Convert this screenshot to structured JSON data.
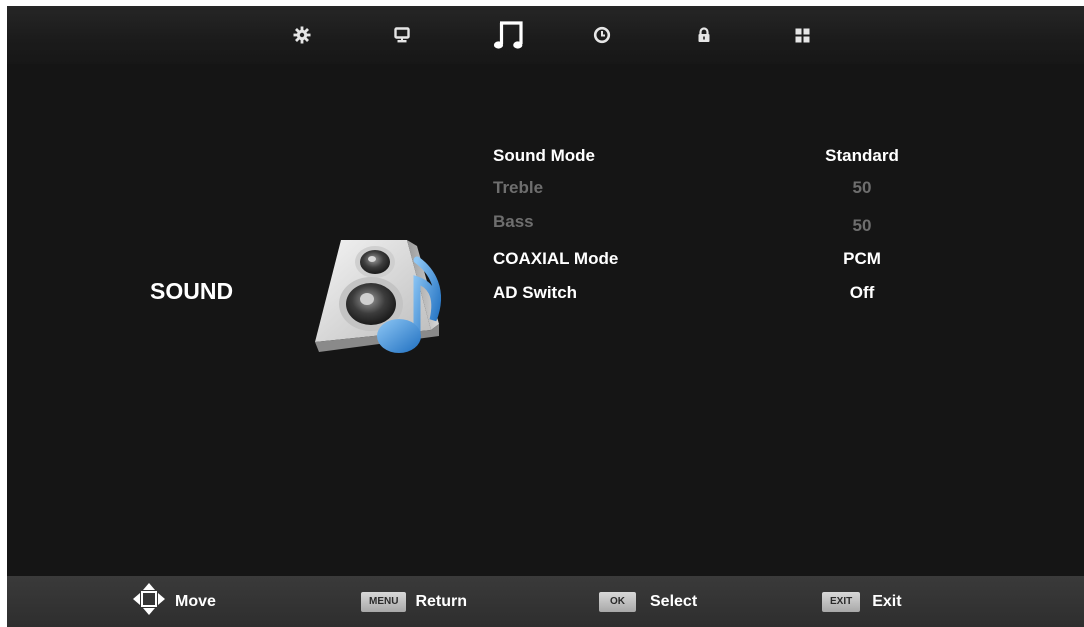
{
  "tabs": [
    {
      "name": "setup-tab",
      "icon": "gear-icon",
      "selected": false
    },
    {
      "name": "picture-tab",
      "icon": "monitor-icon",
      "selected": false
    },
    {
      "name": "sound-tab",
      "icon": "music-note-icon",
      "selected": true
    },
    {
      "name": "time-tab",
      "icon": "clock-icon",
      "selected": false
    },
    {
      "name": "lock-tab",
      "icon": "lock-icon",
      "selected": false
    },
    {
      "name": "apps-tab",
      "icon": "grid-icon",
      "selected": false
    }
  ],
  "section": {
    "title": "SOUND",
    "icon": "speaker-music-icon"
  },
  "menu": [
    {
      "label": "Sound Mode",
      "value": "Standard",
      "enabled": true
    },
    {
      "label": "Treble",
      "value": "50",
      "enabled": false
    },
    {
      "label": "Bass",
      "value": "50",
      "enabled": false
    },
    {
      "label": "COAXIAL Mode",
      "value": "PCM",
      "enabled": true
    },
    {
      "label": "AD Switch",
      "value": "Off",
      "enabled": true
    }
  ],
  "hints": {
    "move": {
      "icon": "direction-pad-icon",
      "label": "Move"
    },
    "return": {
      "key": "MENU",
      "label": "Return"
    },
    "select": {
      "key": "OK",
      "label": "Select"
    },
    "exit": {
      "key": "EXIT",
      "label": "Exit"
    }
  },
  "colors": {
    "background": "#151515",
    "text": "#ffffff",
    "disabled_text": "#6e6e6e",
    "speaker_accent": "#3a86d4"
  }
}
